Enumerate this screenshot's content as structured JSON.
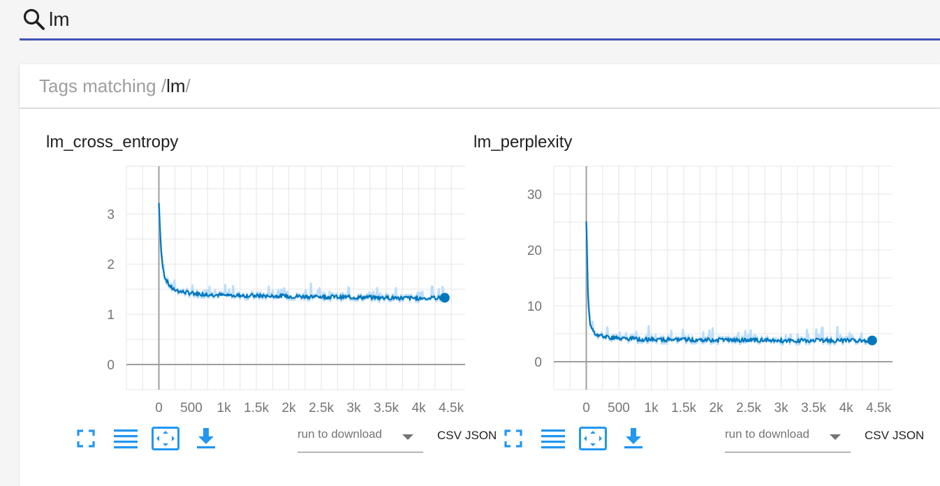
{
  "search": {
    "value": "lm",
    "placeholder": ""
  },
  "tags_header": {
    "prefix": "Tags matching /",
    "pattern": "lm",
    "suffix": "/"
  },
  "colors": {
    "accent": "#3f51b5",
    "series": "#0277bd",
    "series_raw": "#bbdefb",
    "icon": "#2196f3"
  },
  "cards": [
    {
      "title": "lm_cross_entropy",
      "run_select_label": "run to download",
      "csv_label": "CSV",
      "json_label": "JSON"
    },
    {
      "title": "lm_perplexity",
      "run_select_label": "run to download",
      "csv_label": "CSV",
      "json_label": "JSON"
    }
  ],
  "chart_data": [
    {
      "type": "line",
      "title": "lm_cross_entropy",
      "xlim": [
        -500,
        4950
      ],
      "ylim": [
        -0.5,
        3.95
      ],
      "x_ticks": [
        0,
        500,
        1000,
        1500,
        2000,
        2500,
        3000,
        3500,
        4000,
        4500
      ],
      "x_tick_labels": [
        "0",
        "500",
        "1k",
        "1.5k",
        "2k",
        "2.5k",
        "3k",
        "3.5k",
        "4k",
        "4.5k"
      ],
      "y_ticks": [
        0,
        1,
        2,
        3
      ],
      "y_tick_labels": [
        "0",
        "1",
        "2",
        "3"
      ],
      "grid": true,
      "series": [
        {
          "x": [
            0,
            25,
            50,
            75,
            100,
            150,
            200,
            300,
            400,
            500,
            700,
            1000,
            1500,
            2000,
            2500,
            3000,
            3500,
            4000,
            4400
          ],
          "values": [
            3.22,
            2.5,
            2.05,
            1.82,
            1.72,
            1.6,
            1.52,
            1.46,
            1.44,
            1.42,
            1.4,
            1.38,
            1.37,
            1.36,
            1.35,
            1.34,
            1.33,
            1.32,
            1.33
          ]
        }
      ]
    },
    {
      "type": "line",
      "title": "lm_perplexity",
      "xlim": [
        -500,
        4950
      ],
      "ylim": [
        -5,
        35
      ],
      "x_ticks": [
        0,
        500,
        1000,
        1500,
        2000,
        2500,
        3000,
        3500,
        4000,
        4500
      ],
      "x_tick_labels": [
        "0",
        "500",
        "1k",
        "1.5k",
        "2k",
        "2.5k",
        "3k",
        "3.5k",
        "4k",
        "4.5k"
      ],
      "y_ticks": [
        0,
        10,
        20,
        30
      ],
      "y_tick_labels": [
        "0",
        "10",
        "20",
        "30"
      ],
      "grid": true,
      "series": [
        {
          "x": [
            0,
            25,
            50,
            75,
            100,
            150,
            200,
            300,
            400,
            500,
            700,
            1000,
            1500,
            2000,
            2500,
            3000,
            3500,
            4000,
            4400
          ],
          "values": [
            25.5,
            12.5,
            7.5,
            6.2,
            5.6,
            5.0,
            4.7,
            4.4,
            4.3,
            4.2,
            4.1,
            4.0,
            3.95,
            3.9,
            3.85,
            3.8,
            3.8,
            3.75,
            3.8
          ]
        }
      ]
    }
  ]
}
